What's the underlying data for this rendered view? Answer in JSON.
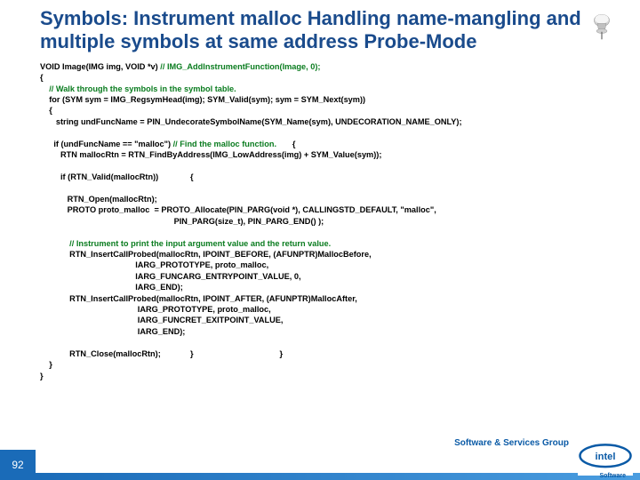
{
  "title": "Symbols: Instrument malloc Handling name-mangling and multiple symbols at same address   Probe-Mode",
  "code": {
    "l1a": "VOID Image(IMG img, VOID *v) ",
    "l1b": "// IMG_AddInstrumentFunction(Image, 0);",
    "l2": "{",
    "l3": "    // Walk through the symbols in the symbol table.",
    "l4": "    for (SYM sym = IMG_RegsymHead(img); SYM_Valid(sym); sym = SYM_Next(sym))",
    "l5": "    {",
    "l6": "       string undFuncName = PIN_UndecorateSymbolName(SYM_Name(sym), UNDECORATION_NAME_ONLY);",
    "l7a": "      if (undFuncName == \"malloc\") ",
    "l7b": "// Find the malloc function.",
    "l7c": "       {",
    "l8": "         RTN mallocRtn = RTN_FindByAddress(IMG_LowAddress(img) + SYM_Value(sym));",
    "l9": "         if (RTN_Valid(mallocRtn))              {",
    "l10": "            RTN_Open(mallocRtn);",
    "l11": "            PROTO proto_malloc  = PROTO_Allocate(PIN_PARG(void *), CALLINGSTD_DEFAULT, \"malloc\",",
    "l12": "                                                           PIN_PARG(size_t), PIN_PARG_END() );",
    "l13": "             // Instrument to print the input argument value and the return value.",
    "l14": "             RTN_InsertCallProbed(mallocRtn, IPOINT_BEFORE, (AFUNPTR)MallocBefore,",
    "l15": "                                          IARG_PROTOTYPE, proto_malloc,",
    "l16": "                                          IARG_FUNCARG_ENTRYPOINT_VALUE, 0,",
    "l17": "                                          IARG_END);",
    "l18": "             RTN_InsertCallProbed(mallocRtn, IPOINT_AFTER, (AFUNPTR)MallocAfter,",
    "l19": "                                           IARG_PROTOTYPE, proto_malloc,",
    "l20": "                                           IARG_FUNCRET_EXITPOINT_VALUE,",
    "l21": "                                           IARG_END);",
    "l22": "             RTN_Close(mallocRtn);             }                                      }",
    "l23": "    }",
    "l24": "}"
  },
  "footer": {
    "group": "Software & Services Group",
    "page": "92",
    "logo_sub": "Software"
  }
}
